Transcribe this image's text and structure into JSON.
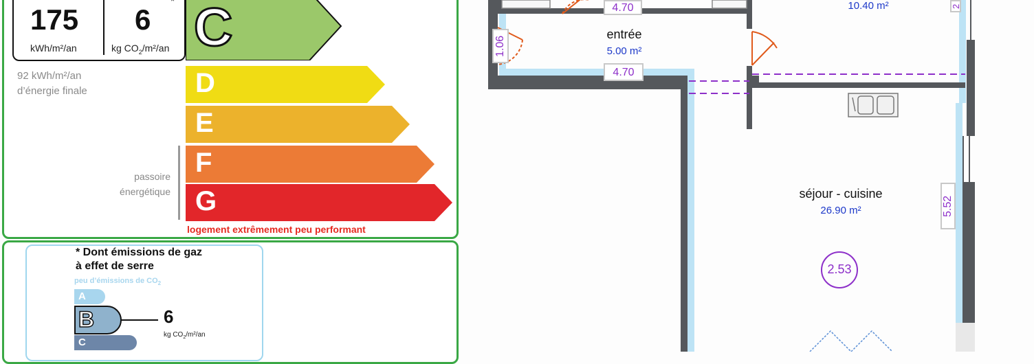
{
  "dpe": {
    "energy_value": "175",
    "energy_unit": "kWh/m²/an",
    "ghg_value": "6",
    "ghg_star": "*",
    "ghg_unit_prefix": "kg CO",
    "ghg_unit_sub": "2",
    "ghg_unit_suffix": "/m²/an",
    "current_class": "C",
    "final_energy_line1": "92 kWh/m²/an",
    "final_energy_line2": "d’énergie finale",
    "ratings": [
      {
        "letter": "C",
        "color": "#9bc86a"
      },
      {
        "letter": "D",
        "color": "#f0dc14"
      },
      {
        "letter": "E",
        "color": "#ecb22c"
      },
      {
        "letter": "F",
        "color": "#ec7b36"
      },
      {
        "letter": "G",
        "color": "#e2262a"
      }
    ],
    "passoire_line1": "passoire",
    "passoire_line2": "énergétique",
    "performance_note": "logement extrêmement peu performant"
  },
  "ghg_box": {
    "title_line1": "* Dont émissions de gaz",
    "title_line2": "à effet de serre",
    "low_label_prefix": "peu d’émissions de CO",
    "low_label_sub": "2",
    "classes": [
      {
        "letter": "A",
        "color": "#a8d6ee"
      },
      {
        "letter": "B",
        "color": "#8fb2cc"
      },
      {
        "letter": "C",
        "color": "#6d86a8"
      }
    ],
    "value": "6",
    "unit_prefix": "kg CO",
    "unit_sub": "2",
    "unit_suffix": "/m²/an"
  },
  "plan": {
    "rooms": [
      {
        "name": "",
        "area": "10.40 m²"
      },
      {
        "name": "entrée",
        "area": "5.00 m²"
      },
      {
        "name": "séjour - cuisine",
        "area": "26.90 m²"
      }
    ],
    "dimensions": {
      "top_width": "4.70",
      "entree_width": "4.70",
      "entree_height": "1.06",
      "sejour_height": "5.52",
      "ceiling_height": "2.53",
      "top_right_fragment": "2"
    },
    "colors": {
      "wall": "#55585c",
      "window": "#bde3f5",
      "door": "#e05a1b",
      "dim": "#8d2fc9"
    }
  }
}
